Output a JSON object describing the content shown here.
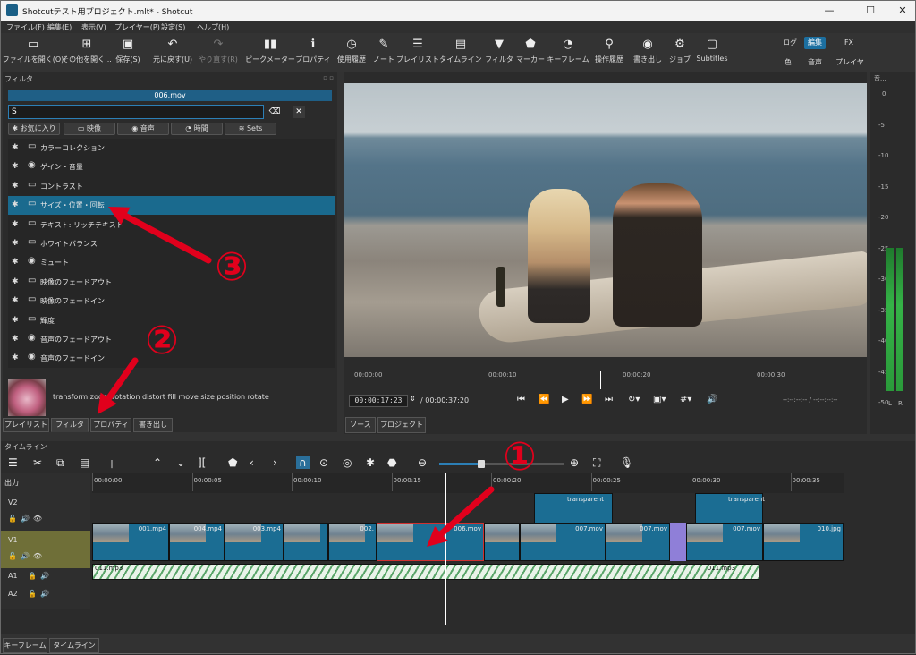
{
  "window": {
    "title": "Shotcutテスト用プロジェクト.mlt* - Shotcut",
    "min": "—",
    "max": "☐",
    "close": "✕"
  },
  "menu": [
    "ファイル(F)",
    "編集(E)",
    "表示(V)",
    "プレイヤー(P)",
    "設定(S)",
    "ヘルプ(H)"
  ],
  "toolbar": {
    "items": [
      {
        "label": "ファイルを開く(O)",
        "icon": "folder-open-icon",
        "glyph": "▭"
      },
      {
        "label": "その他を開く...",
        "icon": "open-other-icon",
        "glyph": "⊞"
      },
      {
        "label": "保存(S)",
        "icon": "save-icon",
        "glyph": "▣"
      },
      {
        "label": "元に戻す(U)",
        "icon": "undo-icon",
        "glyph": "↶"
      },
      {
        "label": "やり直す(R)",
        "icon": "redo-icon",
        "glyph": "↷"
      },
      {
        "label": "ピークメーター",
        "icon": "peak-meter-icon",
        "glyph": "▮▮"
      },
      {
        "label": "プロパティ",
        "icon": "properties-icon",
        "glyph": "ℹ"
      },
      {
        "label": "使用履歴",
        "icon": "history-icon",
        "glyph": "◷"
      },
      {
        "label": "ノート",
        "icon": "notes-icon",
        "glyph": "✎"
      },
      {
        "label": "プレイリスト",
        "icon": "playlist-icon",
        "glyph": "☰"
      },
      {
        "label": "タイムライン",
        "icon": "timeline-icon",
        "glyph": "▤"
      },
      {
        "label": "フィルタ",
        "icon": "filter-icon",
        "glyph": "▼"
      },
      {
        "label": "マーカー",
        "icon": "marker-icon",
        "glyph": "⬟"
      },
      {
        "label": "キーフレーム",
        "icon": "keyframe-icon",
        "glyph": "◔"
      },
      {
        "label": "操作履歴",
        "icon": "action-history-icon",
        "glyph": "⚲"
      },
      {
        "label": "書き出し",
        "icon": "export-icon",
        "glyph": "◉"
      },
      {
        "label": "ジョブ",
        "icon": "jobs-icon",
        "glyph": "⚙"
      },
      {
        "label": "Subtitles",
        "icon": "subtitles-icon",
        "glyph": "▢"
      }
    ],
    "layouts_top": [
      "ログ",
      "編集",
      "FX"
    ],
    "layouts_bottom": [
      "色",
      "音声",
      "プレイヤー"
    ]
  },
  "filter_panel": {
    "title": "フィルタ",
    "clip_name": "006.mov",
    "search_value": "S",
    "categories": [
      "お気に入り",
      "映像",
      "音声",
      "時間",
      "Sets"
    ],
    "filters": [
      {
        "label": "カラーコレクション",
        "type": "video"
      },
      {
        "label": "ゲイン・音量",
        "type": "audio"
      },
      {
        "label": "コントラスト",
        "type": "video"
      },
      {
        "label": "サイズ・位置・回転",
        "type": "video"
      },
      {
        "label": "テキスト: リッチテキスト",
        "type": "video"
      },
      {
        "label": "ホワイトバランス",
        "type": "video"
      },
      {
        "label": "ミュート",
        "type": "audio"
      },
      {
        "label": "映像のフェードアウト",
        "type": "video"
      },
      {
        "label": "映像のフェードイン",
        "type": "video"
      },
      {
        "label": "輝度",
        "type": "video"
      },
      {
        "label": "音声のフェードアウト",
        "type": "audio"
      },
      {
        "label": "音声のフェードイン",
        "type": "audio"
      }
    ],
    "selected_index": 3,
    "description": "transform zoom rotation distort fill move size position rotate",
    "tabs": [
      "プレイリスト",
      "フィルタ",
      "プロパティ",
      "書き出し"
    ]
  },
  "player": {
    "ruler": [
      "00:00:00",
      "00:00:10",
      "00:00:20",
      "00:00:30"
    ],
    "position": "00:00:17:23",
    "duration": "/ 00:00:37:20",
    "inout": "--:--:--:-- / --:--:--:--",
    "tabs": [
      "ソース",
      "プロジェクト"
    ],
    "playhead_fraction": 0.477
  },
  "meter": {
    "title": "音...",
    "scale": [
      "0",
      "-5",
      "-10",
      "-15",
      "-20",
      "-25",
      "-30",
      "-35",
      "-40",
      "-45",
      "-50"
    ],
    "channels": [
      "L",
      "R"
    ]
  },
  "timeline": {
    "title": "タイムライン",
    "output_label": "出力",
    "tracks": [
      "V2",
      "V1",
      "A1",
      "A2"
    ],
    "ruler": [
      "00:00:00",
      "00:00:05",
      "00:00:10",
      "00:00:15",
      "00:00:20",
      "00:00:25",
      "00:00:30",
      "00:00:35"
    ],
    "v1_clips": [
      "001.mp4",
      "004.mp4",
      "003.mp4",
      "",
      "002.",
      "006.mov",
      "",
      "007.mov",
      "007.mov",
      "",
      "007.mov",
      "010.jpg"
    ],
    "v2_clips": [
      "transparent",
      "transparent"
    ],
    "a1_clip": "011.mp3",
    "a1_clip_end": "011.mp3",
    "selected_clip": "006.mov"
  },
  "bottom_tabs": [
    "キーフレーム",
    "タイムライン"
  ],
  "annotations": {
    "n1": "①",
    "n2": "②",
    "n3": "③",
    "color": "#e1001c"
  }
}
